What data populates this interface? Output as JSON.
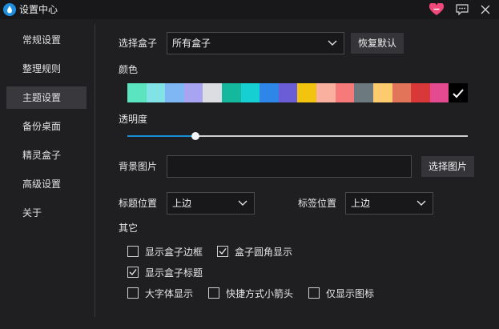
{
  "window": {
    "title": "设置中心"
  },
  "sidebar": {
    "items": [
      {
        "label": "常规设置",
        "active": false
      },
      {
        "label": "整理规则",
        "active": false
      },
      {
        "label": "主题设置",
        "active": true
      },
      {
        "label": "备份桌面",
        "active": false
      },
      {
        "label": "精灵盒子",
        "active": false
      },
      {
        "label": "高级设置",
        "active": false
      },
      {
        "label": "关于",
        "active": false
      }
    ]
  },
  "theme": {
    "box_select": {
      "label": "选择盒子",
      "value": "所有盒子"
    },
    "restore_default": "恢复默认",
    "color_label": "颜色",
    "palette": [
      "#5ae5c0",
      "#82e3e6",
      "#7fb6f4",
      "#a9a4f2",
      "#dcdde2",
      "#14b89c",
      "#16cfd2",
      "#2e87e8",
      "#6a5dd6",
      "#f2c30f",
      "#fab09f",
      "#f77a7b",
      "#6c7a80",
      "#fbcb6d",
      "#e2745a",
      "#d93838",
      "#e44a90",
      "#000000"
    ],
    "selected_color_index": 17,
    "opacity": {
      "label": "透明度",
      "value_fraction": 0.2
    },
    "background_image": {
      "label": "背景图片",
      "value": "",
      "button": "选择图片"
    },
    "title_position": {
      "label": "标题位置",
      "value": "上边"
    },
    "tag_position": {
      "label": "标签位置",
      "value": "上边"
    },
    "other_label": "其它",
    "options": [
      {
        "label": "显示盒子边框",
        "checked": false
      },
      {
        "label": "盒子圆角显示",
        "checked": true
      },
      {
        "label": "显示盒子标题",
        "checked": true
      },
      {
        "label": "大字体显示",
        "checked": false
      },
      {
        "label": "快捷方式小箭头",
        "checked": false
      },
      {
        "label": "仅显示图标",
        "checked": false
      }
    ]
  },
  "colors": {
    "accent": "#1890d6",
    "heart": "#f0487a",
    "app_icon": "#1e8fe0"
  }
}
